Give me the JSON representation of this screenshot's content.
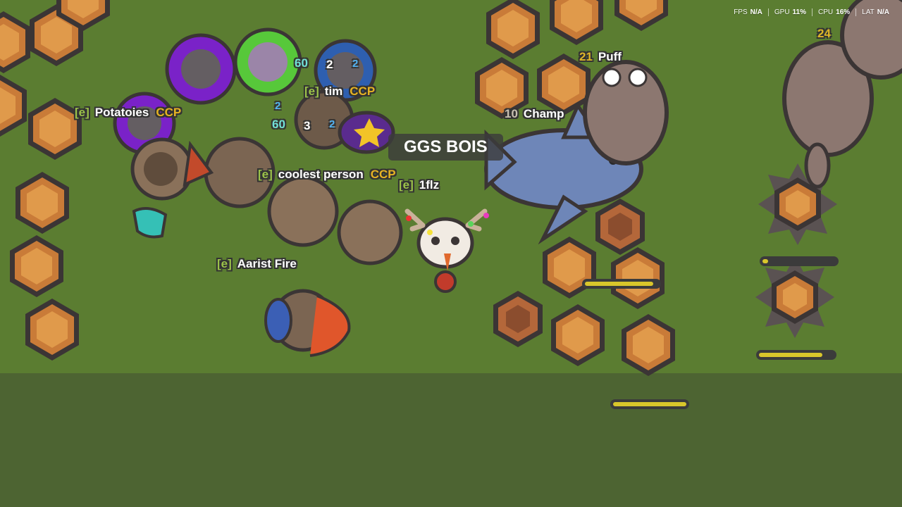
{
  "hud": {
    "fps": {
      "label": "FPS",
      "value": "N/A"
    },
    "gpu": {
      "label": "GPU",
      "value": "11%"
    },
    "cpu": {
      "label": "CPU",
      "value": "16%"
    },
    "lat": {
      "label": "LAT",
      "value": "N/A"
    }
  },
  "banner": "GGS BOIS",
  "players": [
    {
      "clan": "[e]",
      "name": "Potatoies",
      "tribe": "CCP"
    },
    {
      "clan": "[e]",
      "name": "tim",
      "tribe": "CCP"
    },
    {
      "clan": "[e]",
      "name": "coolest person",
      "tribe": "CCP"
    },
    {
      "clan": "[e]",
      "name": "1flz"
    },
    {
      "clan": "[e]",
      "name": "Aarist Fire"
    },
    {
      "level": "10",
      "name": "Champ"
    },
    {
      "level": "21",
      "name": "Puff"
    }
  ],
  "counters": {
    "a": "60",
    "b": "2",
    "c": "2",
    "d": "2",
    "e": "60",
    "f": "3",
    "g": "2",
    "h": "24"
  },
  "health": [
    0.93,
    0.08,
    0.85,
    1.0
  ]
}
